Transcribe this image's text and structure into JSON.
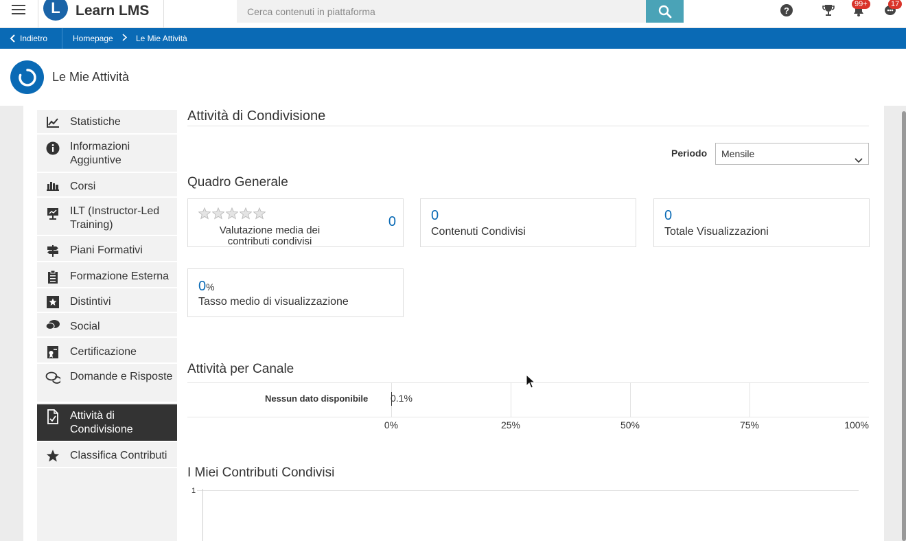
{
  "header": {
    "logo_letter": "L",
    "logo_text": "Learn LMS",
    "search_placeholder": "Cerca contenuti in piattaforma",
    "notifications_badge": "99+",
    "messages_badge": "17"
  },
  "breadcrumb": {
    "back_label": "Indietro",
    "home_label": "Homepage",
    "current_label": "Le Mie Attività"
  },
  "page": {
    "title": "Le Mie Attività"
  },
  "sidebar": {
    "items": [
      {
        "label": "Statistiche",
        "icon": "chart-line-icon"
      },
      {
        "label": "Informazioni Aggiuntive",
        "icon": "info-icon"
      },
      {
        "label": "Corsi",
        "icon": "books-icon"
      },
      {
        "label": "ILT (Instructor-Led Training)",
        "icon": "presentation-icon"
      },
      {
        "label": "Piani Formativi",
        "icon": "signpost-icon"
      },
      {
        "label": "Formazione Esterna",
        "icon": "clipboard-icon"
      },
      {
        "label": "Distintivi",
        "icon": "badge-star-icon"
      },
      {
        "label": "Social",
        "icon": "chat-bubbles-icon"
      },
      {
        "label": "Certificazione",
        "icon": "certificate-icon"
      },
      {
        "label": "Domande e Risposte",
        "icon": "question-chat-icon"
      },
      {
        "label": "Attività di Condivisione",
        "icon": "share-document-icon",
        "active": true
      },
      {
        "label": "Classifica Contributi",
        "icon": "star-icon"
      }
    ]
  },
  "content": {
    "title": "Attività di Condivisione",
    "period_label": "Periodo",
    "period_value": "Mensile",
    "overview_title": "Quadro Generale",
    "cards": {
      "rating": {
        "value": "0",
        "label": "Valutazione media dei contributi condivisi",
        "stars": 5
      },
      "shared": {
        "value": "0",
        "label": "Contenuti Condivisi"
      },
      "views": {
        "value": "0",
        "label": "Totale Visualizzazioni"
      },
      "rate": {
        "value": "0",
        "unit": "%",
        "label": "Tasso medio di visualizzazione"
      }
    },
    "channel_title": "Attività per Canale",
    "contrib_title": "I Miei Contributi Condivisi"
  },
  "chart_data": [
    {
      "type": "bar",
      "orientation": "horizontal",
      "categories": [
        "Nessun dato disponibile"
      ],
      "values": [
        0.1
      ],
      "data_labels": [
        "0.1%"
      ],
      "xlim": [
        0,
        100
      ],
      "x_ticks": [
        "0%",
        "25%",
        "50%",
        "75%",
        "100%"
      ]
    },
    {
      "type": "line",
      "y_ticks": [
        "1"
      ],
      "series": []
    }
  ]
}
